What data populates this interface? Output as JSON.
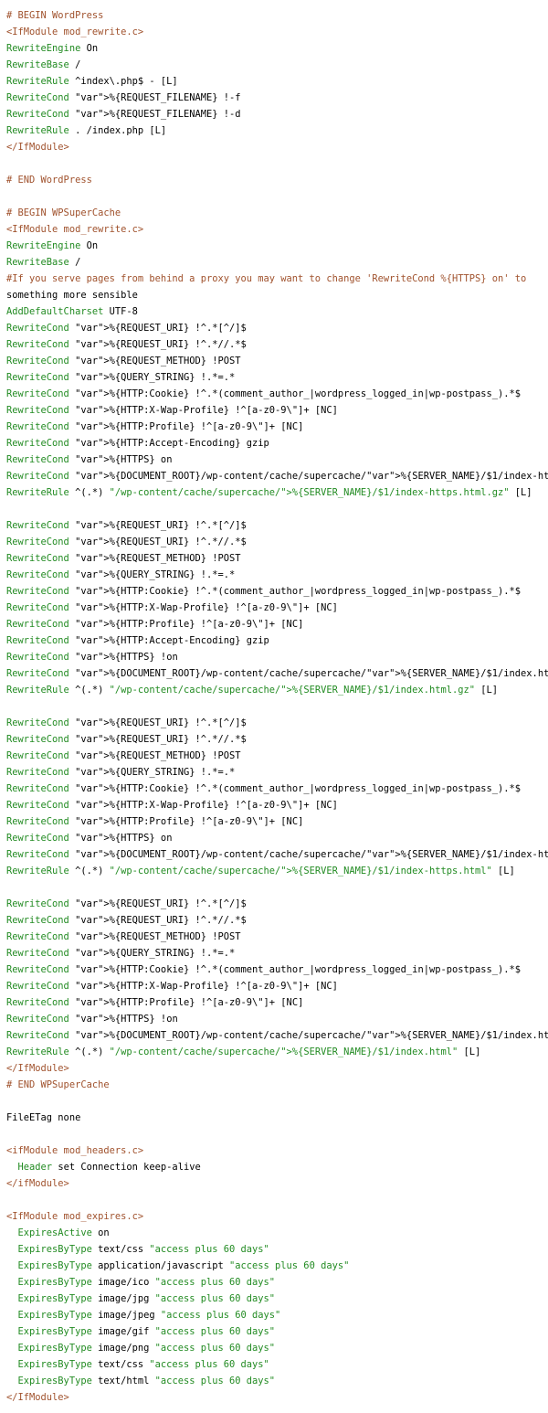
{
  "document": {
    "lines": [
      "# BEGIN WordPress",
      "<IfModule mod_rewrite.c>",
      "RewriteEngine On",
      "RewriteBase /",
      "RewriteRule ^index\\.php$ - [L]",
      "RewriteCond %{REQUEST_FILENAME} !-f",
      "RewriteCond %{REQUEST_FILENAME} !-d",
      "RewriteRule . /index.php [L]",
      "</IfModule>",
      "",
      "# END WordPress",
      "",
      "# BEGIN WPSuperCache",
      "<IfModule mod_rewrite.c>",
      "RewriteEngine On",
      "RewriteBase /",
      "#If you serve pages from behind a proxy you may want to change 'RewriteCond %{HTTPS} on' to",
      "something more sensible",
      "AddDefaultCharset UTF-8",
      "RewriteCond %{REQUEST_URI} !^.*[^/]$",
      "RewriteCond %{REQUEST_URI} !^.*//.*$",
      "RewriteCond %{REQUEST_METHOD} !POST",
      "RewriteCond %{QUERY_STRING} !.*=.*",
      "RewriteCond %{HTTP:Cookie} !^.*(comment_author_|wordpress_logged_in|wp-postpass_).*$",
      "RewriteCond %{HTTP:X-Wap-Profile} !^[a-z0-9\\\"]+ [NC]",
      "RewriteCond %{HTTP:Profile} !^[a-z0-9\\\"]+ [NC]",
      "RewriteCond %{HTTP:Accept-Encoding} gzip",
      "RewriteCond %{HTTPS} on",
      "RewriteCond %{DOCUMENT_ROOT}/wp-content/cache/supercache/%{SERVER_NAME}/$1/index-https.html.gz -f",
      "RewriteRule ^(.*) \"/wp-content/cache/supercache/%{SERVER_NAME}/$1/index-https.html.gz\" [L]",
      "",
      "RewriteCond %{REQUEST_URI} !^.*[^/]$",
      "RewriteCond %{REQUEST_URI} !^.*//.*$",
      "RewriteCond %{REQUEST_METHOD} !POST",
      "RewriteCond %{QUERY_STRING} !.*=.*",
      "RewriteCond %{HTTP:Cookie} !^.*(comment_author_|wordpress_logged_in|wp-postpass_).*$",
      "RewriteCond %{HTTP:X-Wap-Profile} !^[a-z0-9\\\"]+ [NC]",
      "RewriteCond %{HTTP:Profile} !^[a-z0-9\\\"]+ [NC]",
      "RewriteCond %{HTTP:Accept-Encoding} gzip",
      "RewriteCond %{HTTPS} !on",
      "RewriteCond %{DOCUMENT_ROOT}/wp-content/cache/supercache/%{SERVER_NAME}/$1/index.html.gz -f",
      "RewriteRule ^(.*) \"/wp-content/cache/supercache/%{SERVER_NAME}/$1/index.html.gz\" [L]",
      "",
      "RewriteCond %{REQUEST_URI} !^.*[^/]$",
      "RewriteCond %{REQUEST_URI} !^.*//.*$",
      "RewriteCond %{REQUEST_METHOD} !POST",
      "RewriteCond %{QUERY_STRING} !.*=.*",
      "RewriteCond %{HTTP:Cookie} !^.*(comment_author_|wordpress_logged_in|wp-postpass_).*$",
      "RewriteCond %{HTTP:X-Wap-Profile} !^[a-z0-9\\\"]+ [NC]",
      "RewriteCond %{HTTP:Profile} !^[a-z0-9\\\"]+ [NC]",
      "RewriteCond %{HTTPS} on",
      "RewriteCond %{DOCUMENT_ROOT}/wp-content/cache/supercache/%{SERVER_NAME}/$1/index-https.html -f",
      "RewriteRule ^(.*) \"/wp-content/cache/supercache/%{SERVER_NAME}/$1/index-https.html\" [L]",
      "",
      "RewriteCond %{REQUEST_URI} !^.*[^/]$",
      "RewriteCond %{REQUEST_URI} !^.*//.*$",
      "RewriteCond %{REQUEST_METHOD} !POST",
      "RewriteCond %{QUERY_STRING} !.*=.*",
      "RewriteCond %{HTTP:Cookie} !^.*(comment_author_|wordpress_logged_in|wp-postpass_).*$",
      "RewriteCond %{HTTP:X-Wap-Profile} !^[a-z0-9\\\"]+ [NC]",
      "RewriteCond %{HTTP:Profile} !^[a-z0-9\\\"]+ [NC]",
      "RewriteCond %{HTTPS} !on",
      "RewriteCond %{DOCUMENT_ROOT}/wp-content/cache/supercache/%{SERVER_NAME}/$1/index.html -f",
      "RewriteRule ^(.*) \"/wp-content/cache/supercache/%{SERVER_NAME}/$1/index.html\" [L]",
      "</IfModule>",
      "# END WPSuperCache",
      "",
      "FileETag none",
      "",
      "<ifModule mod_headers.c>",
      "  Header set Connection keep-alive",
      "</ifModule>",
      "",
      "<IfModule mod_expires.c>",
      "  ExpiresActive on",
      "  ExpiresByType text/css \"access plus 60 days\"",
      "  ExpiresByType application/javascript \"access plus 60 days\"",
      "  ExpiresByType image/ico \"access plus 60 days\"",
      "  ExpiresByType image/jpg \"access plus 60 days\"",
      "  ExpiresByType image/jpeg \"access plus 60 days\"",
      "  ExpiresByType image/gif \"access plus 60 days\"",
      "  ExpiresByType image/png \"access plus 60 days\"",
      "  ExpiresByType text/css \"access plus 60 days\"",
      "  ExpiresByType text/html \"access plus 60 days\"",
      "</IfModule>"
    ]
  },
  "colors": {
    "background": "#ffffff",
    "text": "#000000",
    "comment": "#a0522d",
    "directive": "#228b22",
    "tag": "#a0522d",
    "variable": "#8b008b",
    "string": "#228b22"
  }
}
